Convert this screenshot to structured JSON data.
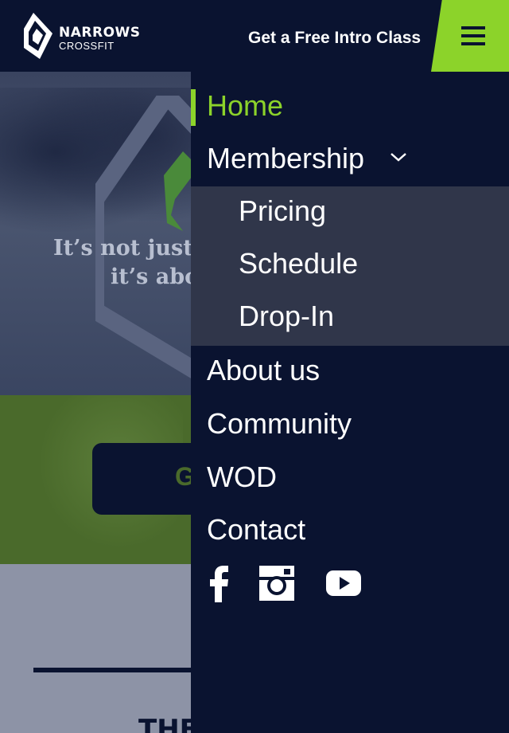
{
  "header": {
    "logo_word1": "NARROWS",
    "logo_word2": "CROSSFIT",
    "cta_label": "Get a Free Intro Class",
    "menu_icon": "hamburger-icon"
  },
  "hero": {
    "quote_line1": "It’s not just",
    "quote_line2": "it’s abo"
  },
  "cta_band": {
    "button_fragment": "G"
  },
  "section": {
    "heading_fragment": "THE"
  },
  "drawer": {
    "items": [
      {
        "label": "Home",
        "active": true
      },
      {
        "label": "Membership",
        "has_submenu": true,
        "chevron_icon": "chevron-down-icon"
      },
      {
        "label": "About us"
      },
      {
        "label": "Community"
      },
      {
        "label": "WOD"
      },
      {
        "label": "Contact"
      }
    ],
    "submenu": [
      {
        "label": "Pricing"
      },
      {
        "label": "Schedule"
      },
      {
        "label": "Drop-In"
      }
    ],
    "social": [
      "facebook-icon",
      "instagram-icon",
      "youtube-icon"
    ]
  },
  "colors": {
    "navy": "#0a1330",
    "accent_green": "#8cd32a",
    "submenu_bg": "#30364a",
    "band_green": "#4a6a2b",
    "band_gray": "#8d93a6"
  }
}
